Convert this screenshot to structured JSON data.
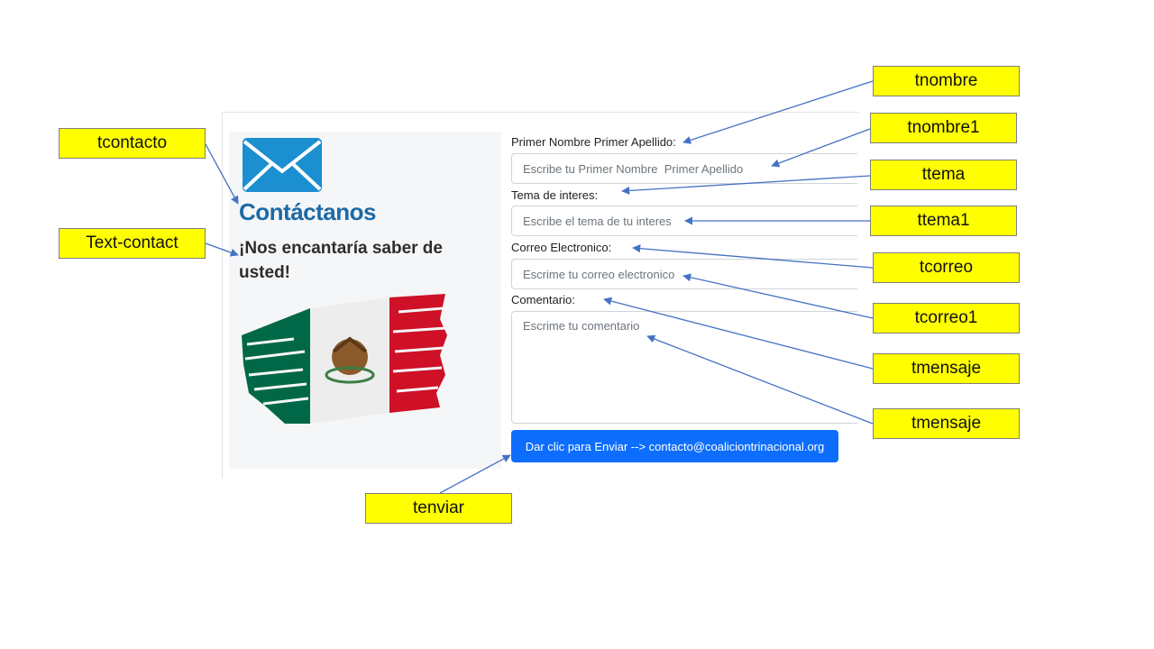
{
  "form": {
    "title": "Contáctanos",
    "subtitle": "¡Nos encantaría saber de usted!",
    "name_label": "Primer Nombre Primer Apellido:",
    "name_placeholder": "Escribe tu Primer Nombre  Primer Apellido",
    "topic_label": "Tema de interes:",
    "topic_placeholder": "Escribe el tema de tu interes",
    "email_label": "Correo Electronico:",
    "email_placeholder": "Escrime tu correo electronico",
    "comment_label": "Comentario:",
    "comment_placeholder": "Escrime tu comentario",
    "send_label": "Dar clic para Enviar --> contacto@coaliciontrinacional.org"
  },
  "callouts": {
    "tcontacto": "tcontacto",
    "text_contact": "Text-contact",
    "tnombre": "tnombre",
    "tnombre1": "tnombre1",
    "ttema": "ttema",
    "ttema1": "ttema1",
    "tcorreo": "tcorreo",
    "tcorreo1": "tcorreo1",
    "tmensaje_a": "tmensaje",
    "tmensaje_b": "tmensaje",
    "tenviar": "tenviar"
  },
  "colors": {
    "title": "#1c6aa6",
    "button": "#0d6efd",
    "callout": "#ffff00",
    "arrow": "#4472c4",
    "flag_green": "#006847",
    "flag_red": "#ce1126"
  },
  "icons": [
    "envelope-icon",
    "mexican-flag"
  ]
}
